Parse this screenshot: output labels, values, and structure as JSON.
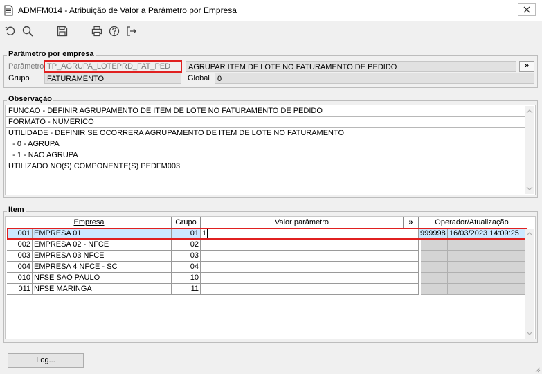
{
  "window": {
    "title": "ADMFM014 - Atribuição de Valor a Parâmetro por Empresa"
  },
  "toolbar": {
    "icons": [
      "undo-icon",
      "search-icon",
      "save-icon",
      "print-icon",
      "help-icon",
      "exit-icon"
    ]
  },
  "param_group": {
    "title": "Parâmetro por empresa",
    "parametro_label": "Parâmetro",
    "parametro_value": "TP_AGRUPA_LOTEPRD_FAT_PED",
    "descricao_value": "AGRUPAR ITEM DE LOTE NO FATURAMENTO DE PEDIDO",
    "expand_label": "»",
    "grupo_label": "Grupo",
    "grupo_value": "FATURAMENTO",
    "global_label": "Global",
    "global_value": "0"
  },
  "observacao": {
    "title": "Observação",
    "lines": [
      "FUNCAO - DEFINIR AGRUPAMENTO DE ITEM DE LOTE NO FATURAMENTO DE PEDIDO",
      "FORMATO - NUMERICO",
      "UTILIDADE - DEFINIR SE OCORRERA AGRUPAMENTO DE ITEM DE LOTE NO FATURAMENTO",
      "  - 0 - AGRUPA",
      "  - 1 - NAO AGRUPA",
      "UTILIZADO NO(S) COMPONENTE(S) PEDFM003"
    ]
  },
  "item": {
    "title": "Item",
    "headers": {
      "empresa": "Empresa",
      "grupo": "Grupo",
      "valor": "Valor parâmetro",
      "expand": "»",
      "operador": "Operador/Atualização"
    },
    "rows": [
      {
        "code": "001",
        "empresa": "EMPRESA 01",
        "grupo": "01",
        "valor": "1",
        "operador": "999998",
        "atualizacao": "16/03/2023 14:09:25",
        "selected": true
      },
      {
        "code": "002",
        "empresa": "EMPRESA 02 - NFCE",
        "grupo": "02",
        "valor": "",
        "operador": "",
        "atualizacao": ""
      },
      {
        "code": "003",
        "empresa": "EMPRESA 03 NFCE",
        "grupo": "03",
        "valor": "",
        "operador": "",
        "atualizacao": ""
      },
      {
        "code": "004",
        "empresa": "EMPRESA 4 NFCE - SC",
        "grupo": "04",
        "valor": "",
        "operador": "",
        "atualizacao": ""
      },
      {
        "code": "010",
        "empresa": "NFSE SAO PAULO",
        "grupo": "10",
        "valor": "",
        "operador": "",
        "atualizacao": ""
      },
      {
        "code": "011",
        "empresa": "NFSE MARINGA",
        "grupo": "11",
        "valor": "",
        "operador": "",
        "atualizacao": ""
      }
    ]
  },
  "footer": {
    "log_label": "Log..."
  },
  "colors": {
    "highlight_border": "#e02020",
    "selected_row": "#cce8ff"
  }
}
